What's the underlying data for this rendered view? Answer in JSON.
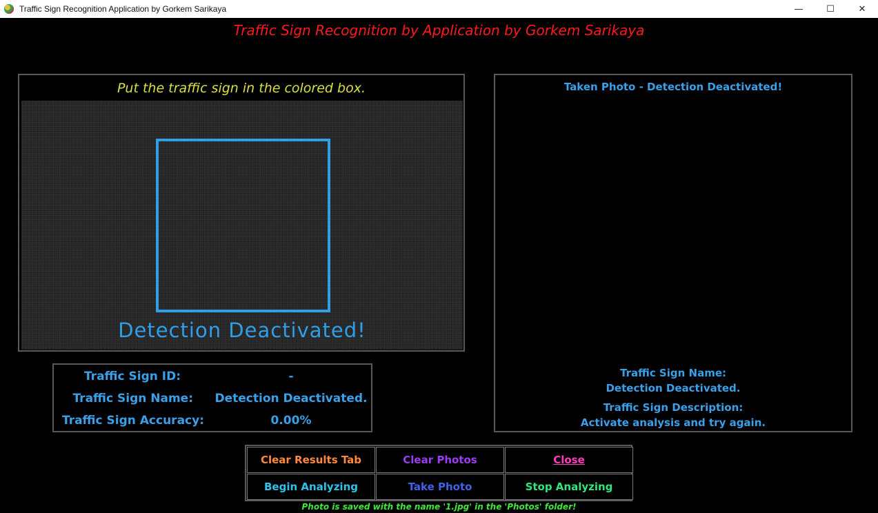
{
  "window": {
    "title": "Traffic Sign Recognition Application by Gorkem Sarikaya",
    "minimize_glyph": "—",
    "maximize_glyph": "☐",
    "close_glyph": "✕"
  },
  "heading": "Traffic Sign Recognition by Application by Gorkem Sarikaya",
  "camera": {
    "caption": "Put the traffic sign in the colored box.",
    "status": "Detection Deactivated!"
  },
  "info": {
    "id_label": "Traffic Sign ID:",
    "id_value": "-",
    "name_label": "Traffic Sign Name:",
    "name_value": "Detection Deactivated.",
    "accuracy_label": "Traffic Sign Accuracy:",
    "accuracy_value": "0.00%"
  },
  "photo": {
    "title": "Taken Photo - Detection Deactivated!",
    "name_label": "Traffic Sign Name:",
    "name_value": "Detection Deactivated.",
    "desc_label": "Traffic Sign Description:",
    "desc_value": "Activate analysis and try again."
  },
  "buttons": {
    "clear_results": "Clear Results Tab",
    "clear_photos": "Clear Photos",
    "close": "Close",
    "begin": "Begin Analyzing",
    "take": "Take Photo",
    "stop": "Stop Analyzing"
  },
  "footer": "Photo is saved with the name '1.jpg' in the 'Photos' folder!",
  "colors": {
    "heading": "#ff1a1a",
    "caption": "#d8e040",
    "accent_blue": "#2e9fe8",
    "footer": "#3ee83a"
  }
}
